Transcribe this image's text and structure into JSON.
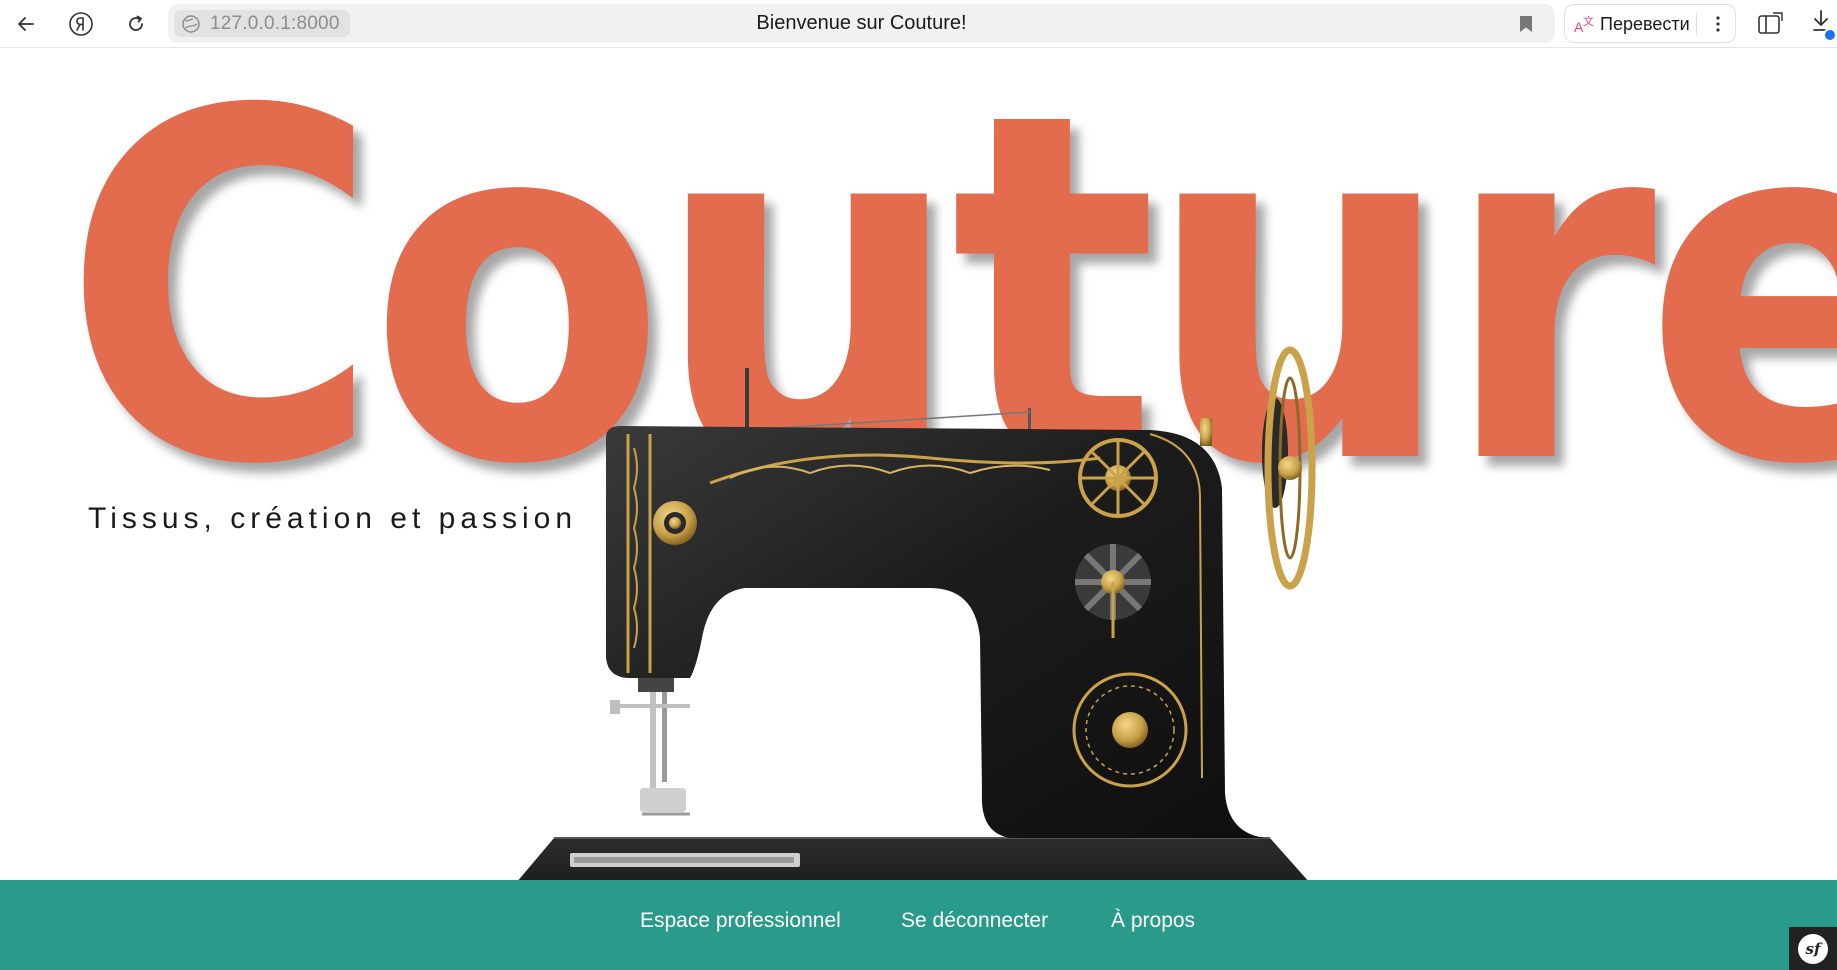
{
  "browser": {
    "url": "127.0.0.1:8000",
    "page_title": "Bienvenue sur Couture!",
    "translate_label": "Перевести",
    "icons": {
      "back": "arrow-left-icon",
      "yandex": "yandex-logo-icon",
      "reload": "reload-icon",
      "site_info": "globe-icon",
      "bookmark": "bookmark-icon",
      "translate": "translate-icon",
      "menu": "kebab-menu-icon",
      "sidebar": "sidebar-toggle-icon",
      "downloads": "downloads-icon"
    }
  },
  "hero": {
    "title": "Couture",
    "tagline": "Tissus, création et passion",
    "image": "vintage-sewing-machine"
  },
  "footer": {
    "links": [
      {
        "label": "Espace professionnel"
      },
      {
        "label": "Se déconnecter"
      },
      {
        "label": "À propos"
      }
    ]
  },
  "debug_toolbar": {
    "logo_text": "sf"
  },
  "colors": {
    "title": "#e36c4e",
    "footer_bg": "#2a9a8a",
    "footer_text": "#ffffff",
    "machine_body": "#1e1e1e",
    "machine_trim": "#c9a24a",
    "download_badge": "#1a73e8"
  }
}
